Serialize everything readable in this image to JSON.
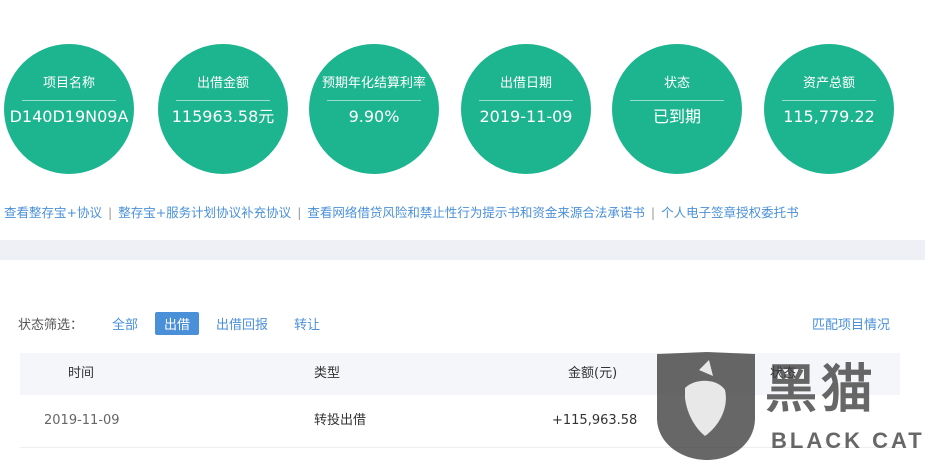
{
  "summary": [
    {
      "label": "项目名称",
      "value": "D140D19N09A"
    },
    {
      "label": "出借金额",
      "value": "115963.58元"
    },
    {
      "label": "预期年化结算利率",
      "value": "9.90%"
    },
    {
      "label": "出借日期",
      "value": "2019-11-09"
    },
    {
      "label": "状态",
      "value": "已到期"
    },
    {
      "label": "资产总额",
      "value": "115,779.22"
    }
  ],
  "links": [
    "查看整存宝+协议",
    "整存宝+服务计划协议补充协议",
    "查看网络借贷风险和禁止性行为提示书和资金来源合法承诺书",
    "个人电子签章授权委托书"
  ],
  "link_separator": "|",
  "filter": {
    "label": "状态筛选：",
    "tabs": [
      "全部",
      "出借",
      "出借回报",
      "转让"
    ],
    "active": "出借"
  },
  "match_link": "匹配项目情况",
  "table": {
    "headers": {
      "time": "时间",
      "type": "类型",
      "amount": "金额(元)",
      "status": "状态"
    },
    "rows": [
      {
        "time": "2019-11-09",
        "type": "转投出借",
        "amount": "+115,963.58",
        "status": ""
      }
    ]
  },
  "watermark": {
    "brand": "黑猫",
    "latin": "BLACK CAT"
  },
  "colors": {
    "accent": "#1db58f",
    "link": "#4a90d9"
  }
}
